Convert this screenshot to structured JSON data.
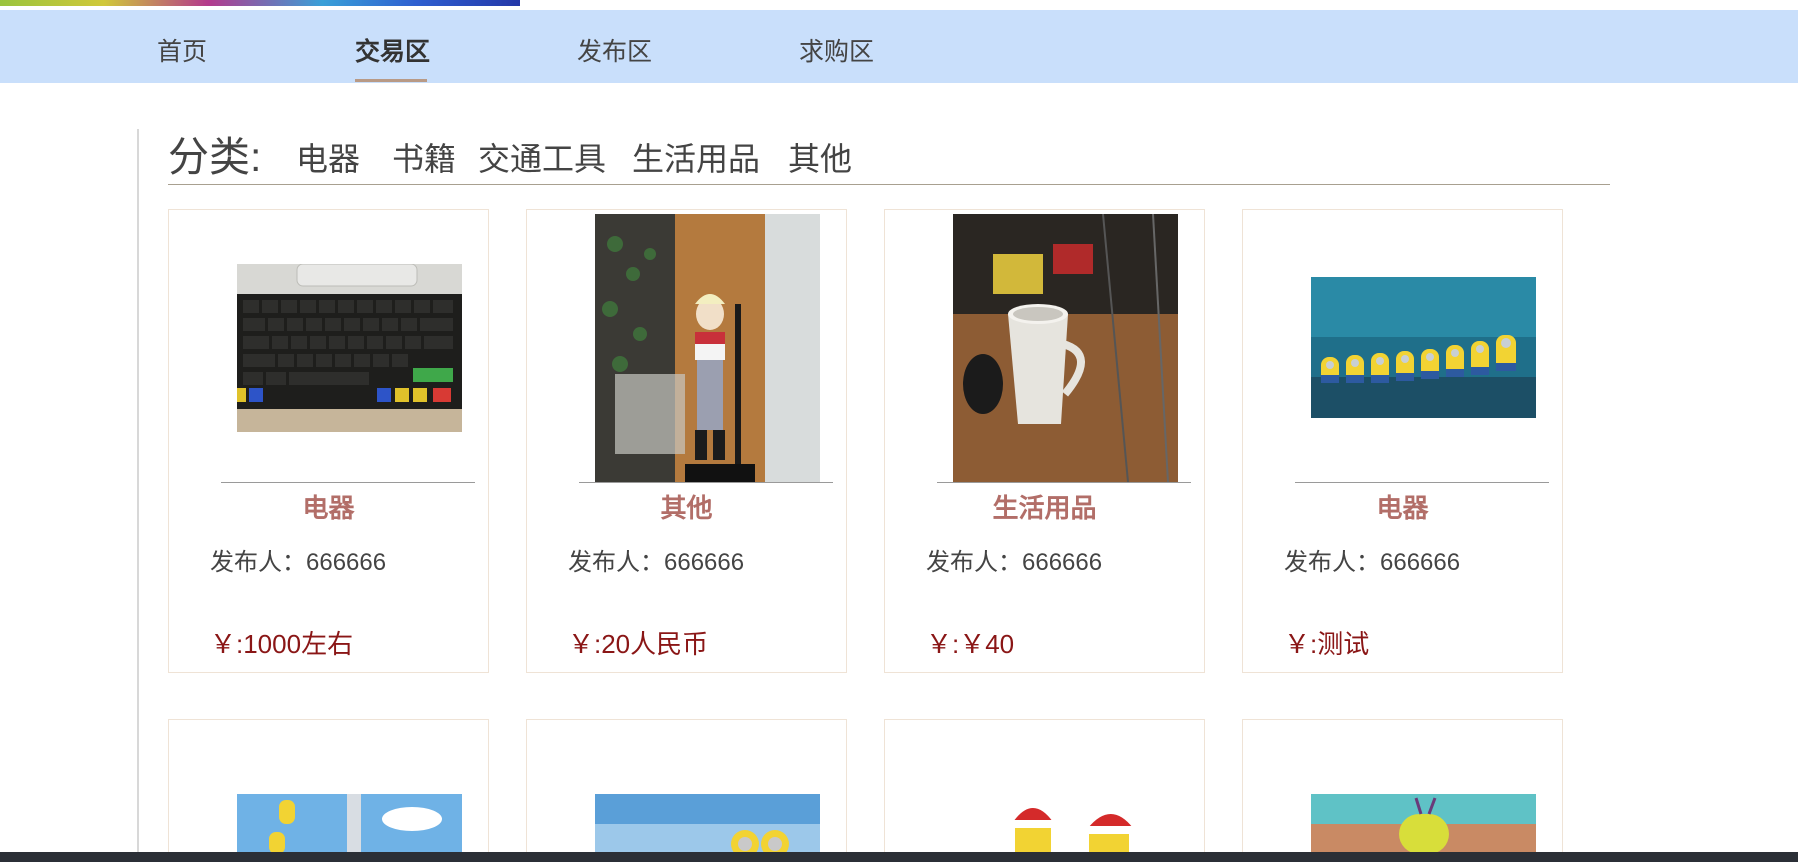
{
  "nav": {
    "items": [
      {
        "label": "首页"
      },
      {
        "label": "交易区"
      },
      {
        "label": "发布区"
      },
      {
        "label": "求购区"
      }
    ],
    "active": "交易区"
  },
  "categories": {
    "label": "分类:",
    "items": [
      "电器",
      "书籍",
      "交通工具",
      "生活用品",
      "其他"
    ]
  },
  "products": [
    {
      "image": "keyboard-photo",
      "category": "电器",
      "publisher": "发布人：666666",
      "price": "￥:1000左右"
    },
    {
      "image": "figure-photo",
      "category": "其他",
      "publisher": "发布人：666666",
      "price": "￥:20人民币"
    },
    {
      "image": "mug-photo",
      "category": "生活用品",
      "publisher": "发布人：666666",
      "price": "￥:￥40"
    },
    {
      "image": "minions-photo",
      "category": "电器",
      "publisher": "发布人：666666",
      "price": "￥:测试"
    }
  ],
  "second_row_images": [
    "minion-balloon-photo",
    "minions-sky-photo",
    "minions-santa-photo",
    "minion-beach-photo"
  ],
  "colors": {
    "nav_bg": "#c9dffb",
    "category_text": "#b26e68",
    "price_text": "#8a1616",
    "card_border": "#efe3d6"
  }
}
